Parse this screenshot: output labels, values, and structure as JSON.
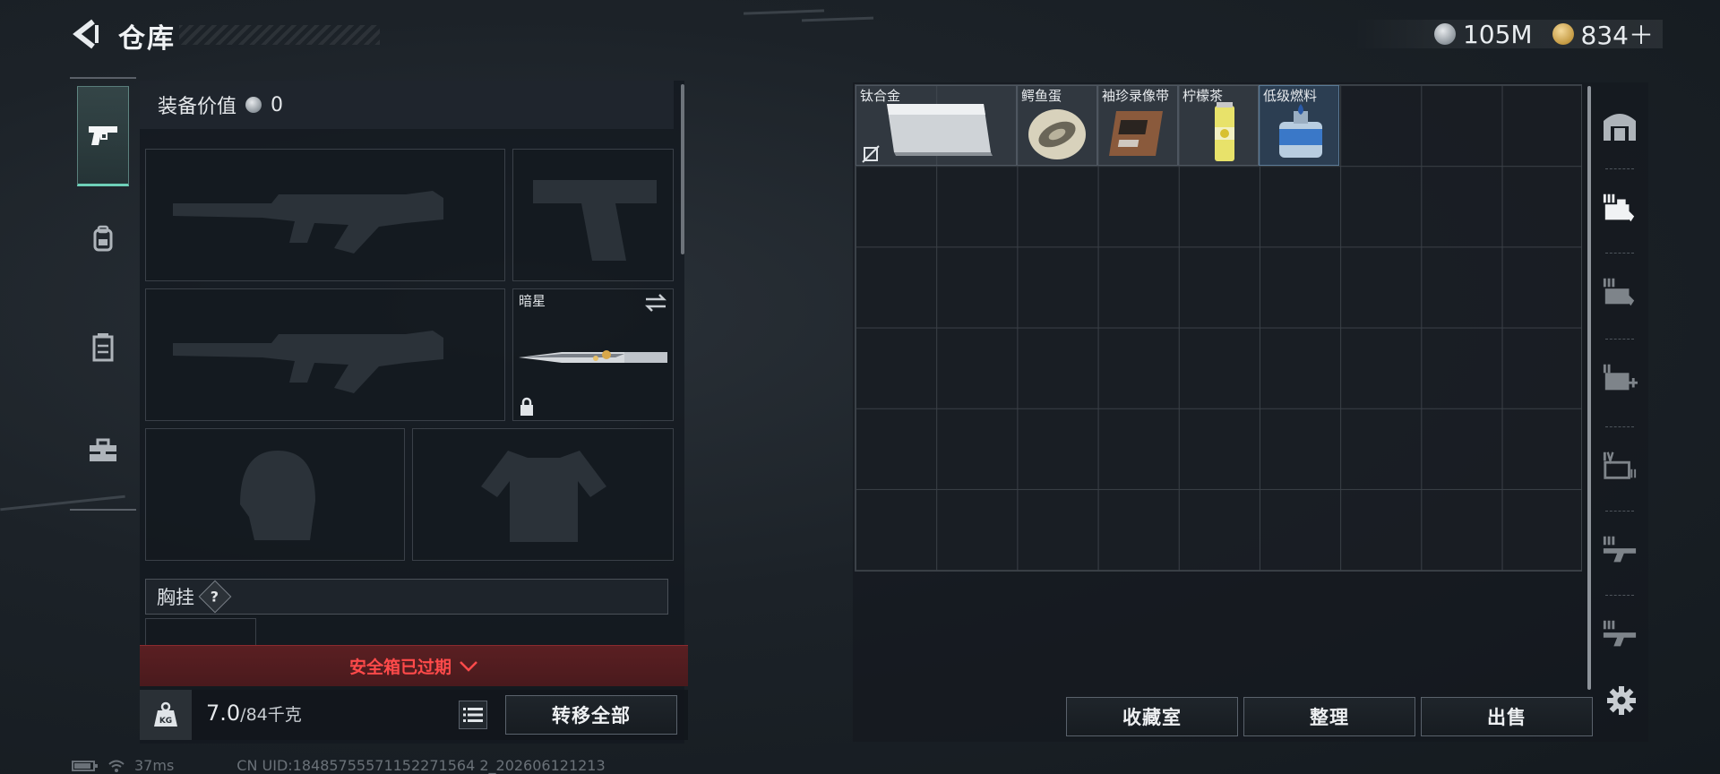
{
  "header": {
    "title": "仓库",
    "currencies": [
      {
        "icon": "silver-coin-icon",
        "value": "105M"
      },
      {
        "icon": "gold-coin-icon",
        "value": "834＋"
      }
    ]
  },
  "side_tabs": [
    "pistol-icon",
    "backpack-icon",
    "chest-rig-icon",
    "toolbox-icon"
  ],
  "equipment": {
    "value_label": "装备价值",
    "value": "0",
    "melee_slot_label": "暗星",
    "chest_label": "胸挂",
    "help_mark": "?",
    "expired_text": "安全箱已过期",
    "weight_value": "7.0",
    "weight_max": "/84千克",
    "weight_icon_text": "KG",
    "transfer_all": "转移全部"
  },
  "storage": {
    "items": [
      {
        "name": "钛合金",
        "color": "#5b636d"
      },
      {
        "name": "鳄鱼蛋",
        "color": "#5b636d"
      },
      {
        "name": "袖珍录像带",
        "color": "#5b636d"
      },
      {
        "name": "柠檬茶",
        "color": "#5b636d"
      },
      {
        "name": "低级燃料",
        "color": "#4a6f8f"
      }
    ],
    "buttons": {
      "collection": "收藏室",
      "organize": "整理",
      "sell": "出售"
    },
    "right_tabs": [
      "safehouse-icon",
      "storage-iii-icon",
      "storage-iii-b-icon",
      "medical-storage-icon",
      "storage-iv-icon",
      "weapon-storage-iii-icon",
      "weapon-storage-iii-b-icon",
      "settings-gear-icon"
    ]
  },
  "status": {
    "ping": "37ms",
    "uid": "CN UID:18485755571152271564 2_202606121213"
  },
  "colors": {
    "accent_teal": "#6ed0b8",
    "danger_red": "#ff4a4a",
    "banner_bg": "#5a1f22"
  }
}
